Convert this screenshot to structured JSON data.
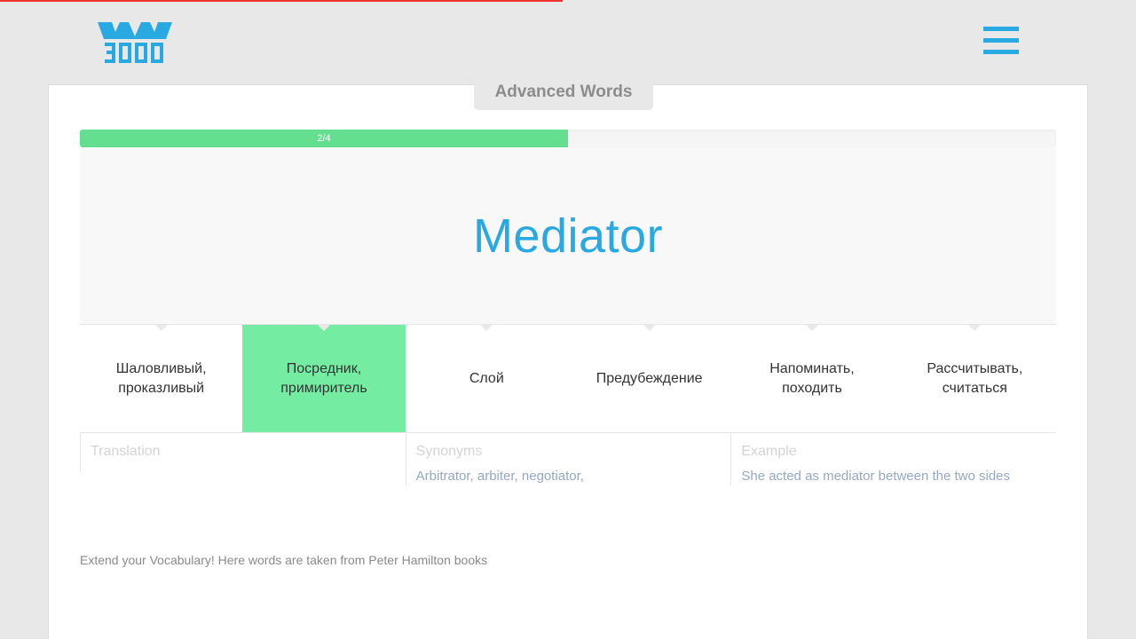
{
  "header": {
    "logo_text": "3000",
    "logo_icon": "w3000-logo-icon",
    "menu_icon": "hamburger-menu-icon"
  },
  "page_progress_percent": 49.5,
  "card": {
    "title": "Advanced Words",
    "progress": {
      "label": "2/4",
      "fraction": 0.5,
      "color": "#63df8f"
    },
    "word": "Mediator",
    "options": [
      {
        "lines": [
          "Шаловливый,",
          "проказливый"
        ],
        "selected": false
      },
      {
        "lines": [
          "Посредник,",
          "примиритель"
        ],
        "selected": true
      },
      {
        "lines": [
          "Слой"
        ],
        "selected": false
      },
      {
        "lines": [
          "Предубеждение"
        ],
        "selected": false
      },
      {
        "lines": [
          "Напоминать,",
          "походить"
        ],
        "selected": false
      },
      {
        "lines": [
          "Рассчитывать,",
          "считаться"
        ],
        "selected": false
      }
    ],
    "info": {
      "translation_label": "Translation",
      "translation_value": "",
      "synonyms_label": "Synonyms",
      "synonyms_value": "Arbitrator, arbiter, negotiator,",
      "example_label": "Example",
      "example_value": "She acted as mediator between the two sides"
    }
  },
  "footer": {
    "note": "Extend your Vocabulary! Here words are taken from Peter Hamilton books"
  },
  "colors": {
    "accent": "#29a9e1",
    "progress": "#63df8f",
    "selected_option": "#74eda2",
    "top_bar": "#f23131"
  }
}
